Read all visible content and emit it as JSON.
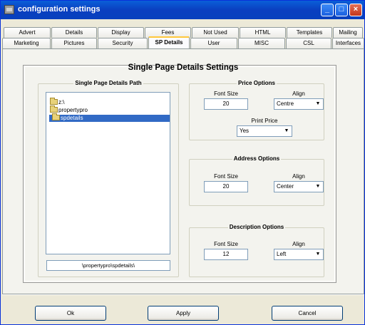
{
  "window": {
    "title": "configuration settings"
  },
  "tabs": {
    "row1": [
      "Advert",
      "Details",
      "Display",
      "Fees",
      "Not Used",
      "HTML",
      "Templates",
      "Mailing"
    ],
    "row2": [
      "Marketing",
      "Pictures",
      "Security",
      "SP Details",
      "User",
      "MISC",
      "CSL",
      "Interfaces"
    ],
    "active": "SP Details"
  },
  "page": {
    "heading": "Single Page Details Settings",
    "path_group": {
      "title": "Single Page Details Path",
      "tree": [
        "z:\\",
        "propertypro",
        "spdetails"
      ],
      "selected": "spdetails",
      "path_value": "\\propertypro\\spdetails\\"
    },
    "price": {
      "title": "Price Options",
      "font_size_label": "Font Size",
      "font_size": "20",
      "align_label": "Align",
      "align": "Centre",
      "print_label": "Print Price",
      "print": "Yes"
    },
    "address": {
      "title": "Address Options",
      "font_size_label": "Font Size",
      "font_size": "20",
      "align_label": "Align",
      "align": "Center"
    },
    "description": {
      "title": "Description Options",
      "font_size_label": "Font Size",
      "font_size": "12",
      "align_label": "Align",
      "align": "Left"
    }
  },
  "buttons": {
    "ok": "Ok",
    "apply": "Apply",
    "cancel": "Cancel"
  }
}
